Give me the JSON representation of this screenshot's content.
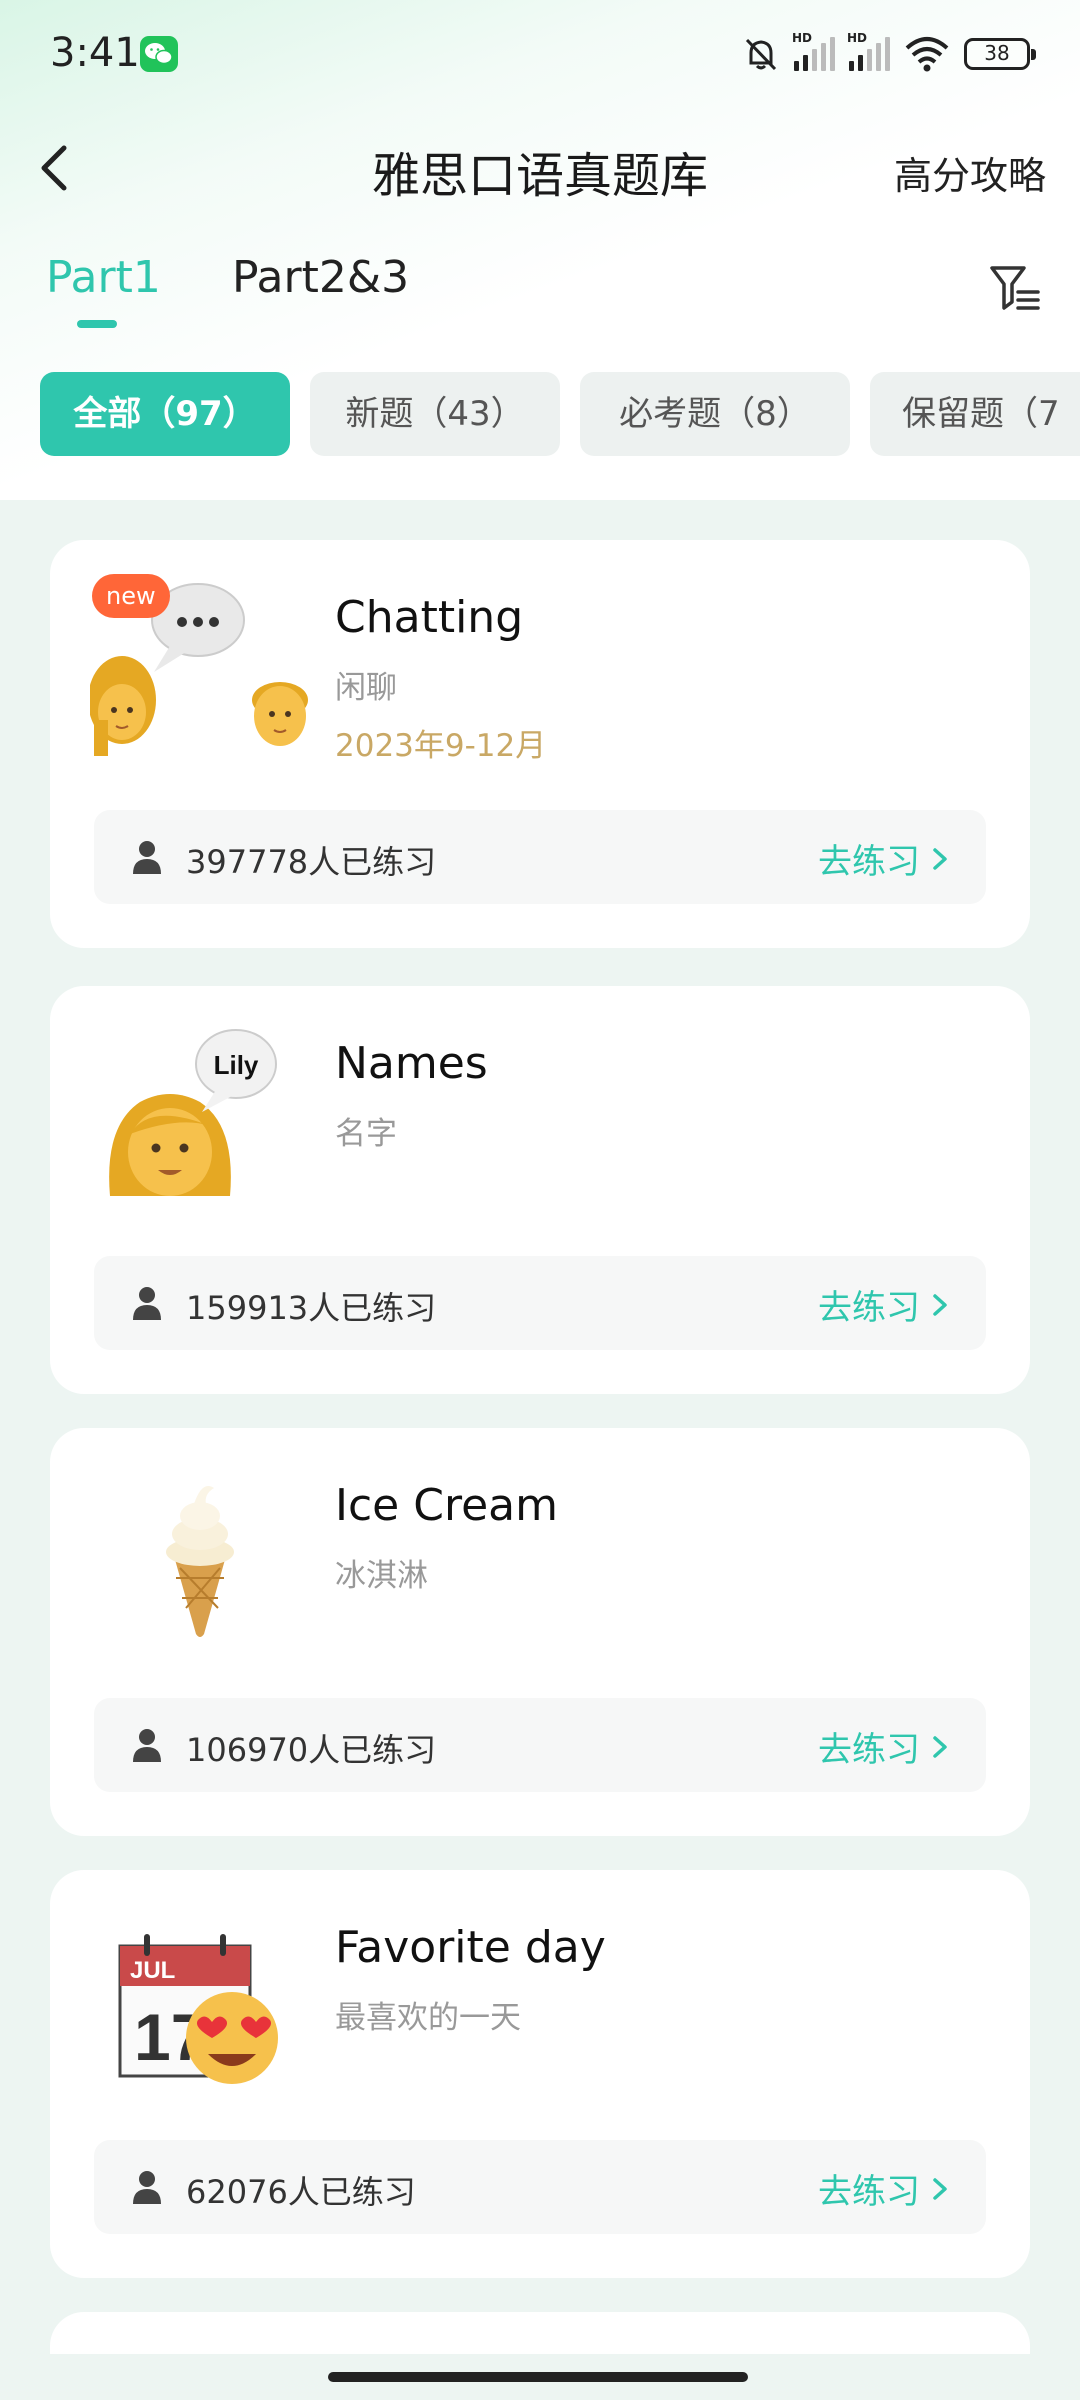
{
  "status_bar": {
    "time": "3:41",
    "battery": "38",
    "icons": [
      "wechat-icon",
      "mute-icon",
      "signal-hd-icon",
      "signal-hd-icon",
      "wifi-icon",
      "battery-icon"
    ]
  },
  "header": {
    "back_icon": "chevron-left-icon",
    "title": "雅思口语真题库",
    "strategy": "高分攻略"
  },
  "tabs": [
    {
      "label": "Part1",
      "active": true
    },
    {
      "label": "Part2&3",
      "active": false
    }
  ],
  "filter_icon": "filter-list-icon",
  "chips": [
    {
      "label": "全部（97）",
      "active": true
    },
    {
      "label": "新题（43）",
      "active": false
    },
    {
      "label": "必考题（8）",
      "active": false
    },
    {
      "label": "保留题（7",
      "active": false
    }
  ],
  "cards": [
    {
      "title": "Chatting",
      "subtitle": "闲聊",
      "date": "2023年9-12月",
      "badge": "new",
      "illustration": "two-people-chat-illustration",
      "practice_count": "397778人已练习",
      "action": "去练习"
    },
    {
      "title": "Names",
      "subtitle": "名字",
      "illustration": "woman-speech-bubble-illustration",
      "bubble_text": "Lily",
      "practice_count": "159913人已练习",
      "action": "去练习"
    },
    {
      "title": "Ice Cream",
      "subtitle": "冰淇淋",
      "illustration": "ice-cream-cone-illustration",
      "practice_count": "106970人已练习",
      "action": "去练习"
    },
    {
      "title": "Favorite day",
      "subtitle": "最喜欢的一天",
      "illustration": "calendar-heart-eyes-illustration",
      "calendar_month": "JUL",
      "calendar_day": "17",
      "practice_count": "62076人已练习",
      "action": "去练习"
    }
  ],
  "colors": {
    "accent": "#2fc6ad",
    "date": "#c9a865",
    "badge": "#ff6638",
    "background": "#edf5f2"
  }
}
